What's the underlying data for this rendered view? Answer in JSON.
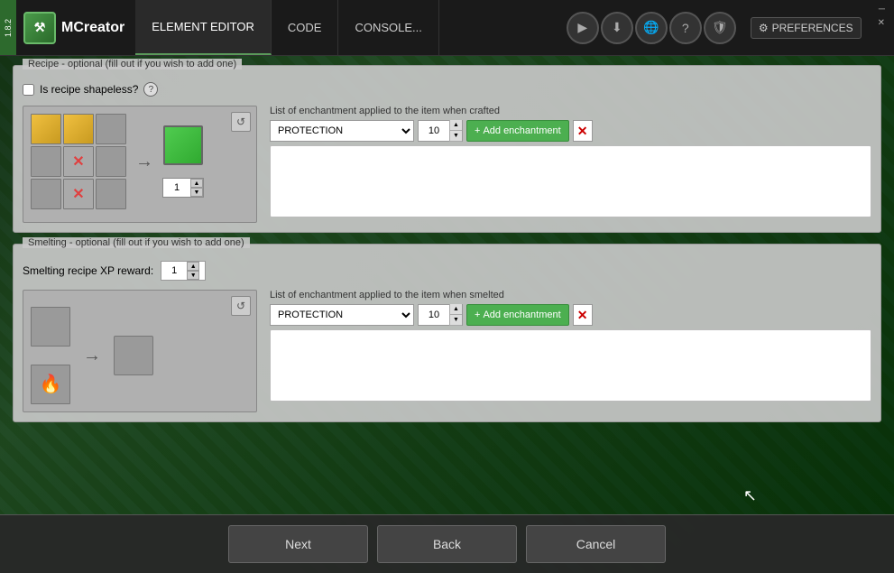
{
  "app": {
    "version": "1.8.2",
    "name": "MCreator",
    "nav": [
      {
        "id": "element-editor",
        "label": "ELEMENT EDITOR",
        "active": true
      },
      {
        "id": "code",
        "label": "CODE"
      },
      {
        "id": "console",
        "label": "CONSOLE..."
      }
    ],
    "icons": [
      "play",
      "download",
      "globe",
      "help",
      "settings"
    ],
    "preferences_label": "PREFERENCES",
    "win_controls": {
      "minimize": "─",
      "close": "✕"
    }
  },
  "recipe_section": {
    "title": "Recipe - optional (fill out if you wish to add one)",
    "shapeless_label": "Is recipe shapeless?",
    "enchant_list_label": "List of enchantment applied to the item when crafted",
    "enchant_default": "PROTECTION",
    "enchant_level": "10",
    "add_enchant_label": "Add enchantment",
    "reset_icon": "↺",
    "output_count": "1"
  },
  "smelting_section": {
    "title": "Smelting - optional (fill out if you wish to add one)",
    "xp_label": "Smelting recipe XP reward:",
    "xp_value": "1",
    "enchant_list_label": "List of enchantment applied to the item when smelted",
    "enchant_default": "PROTECTION",
    "enchant_level": "10",
    "add_enchant_label": "Add enchantment",
    "reset_icon": "↺"
  },
  "bottom_buttons": {
    "next": "Next",
    "back": "Back",
    "cancel": "Cancel"
  },
  "grid_items": {
    "recipe": [
      "gold",
      "gold",
      "empty",
      "empty",
      "cyan-x",
      "empty",
      "empty",
      "cyan-x",
      "empty"
    ],
    "output": "green"
  },
  "cursor": "⬆"
}
